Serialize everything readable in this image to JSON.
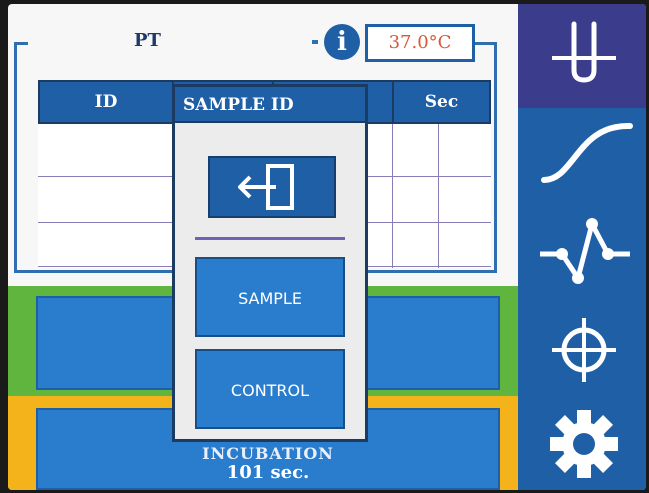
{
  "header": {
    "test_name": "PT",
    "info_icon_glyph": "i",
    "temperature": "37.0°C"
  },
  "table": {
    "columns": [
      "ID",
      "",
      "",
      "Sec"
    ],
    "rows": [
      [
        "",
        "",
        "",
        ""
      ],
      [
        "",
        "",
        "",
        ""
      ],
      [
        "",
        "",
        "",
        ""
      ]
    ]
  },
  "panels": {
    "incubation_label": "INCUBATION",
    "incubation_time": "101 sec."
  },
  "popup": {
    "title": "SAMPLE ID",
    "exit_icon": "exit-door-icon",
    "options": [
      "SAMPLE",
      "CONTROL"
    ]
  },
  "sidebar": {
    "items": [
      {
        "icon": "test-tube-icon"
      },
      {
        "icon": "curve-icon"
      },
      {
        "icon": "network-icon"
      },
      {
        "icon": "crosshair-icon"
      },
      {
        "icon": "gear-icon"
      }
    ]
  },
  "colors": {
    "primary": "#1f5fa6",
    "green": "#5fb53e",
    "yellow": "#f4b21b",
    "temperature_text": "#d55a3c"
  }
}
